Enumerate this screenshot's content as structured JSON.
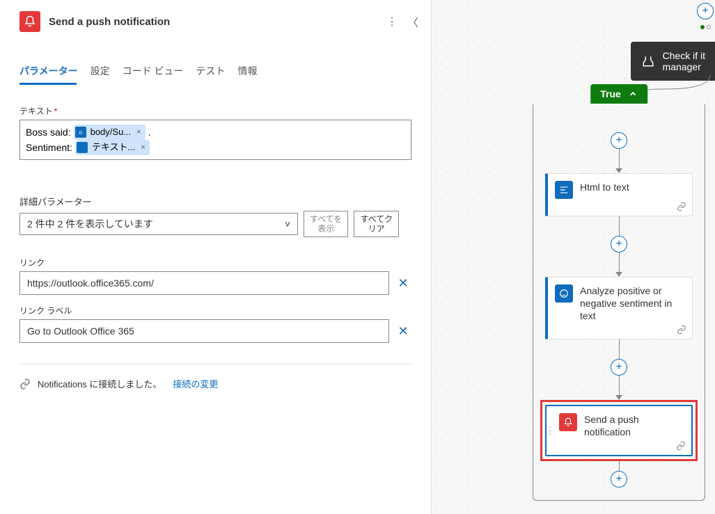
{
  "header": {
    "title": "Send a push notification"
  },
  "tabs": {
    "parameters": "パラメーター",
    "settings": "設定",
    "code_view": "コード ビュー",
    "test": "テスト",
    "info": "情報"
  },
  "text_field": {
    "label": "テキスト",
    "line1_prefix": "Boss said:",
    "token1": "body/Su...",
    "line1_suffix": ".",
    "line2_prefix": "Sentiment:",
    "token2": "テキスト..."
  },
  "adv": {
    "label": "詳細パラメーター",
    "dropdown": "2 件中 2 件を表示しています",
    "show_all": "すべてを\n表示",
    "clear_all": "すべてク\nリア"
  },
  "link": {
    "label": "リンク",
    "value": "https://outlook.office365.com/"
  },
  "link_label": {
    "label": "リンク ラベル",
    "value": "Go to Outlook Office 365"
  },
  "connection": {
    "status": "Notifications に接続しました。",
    "change": "接続の変更"
  },
  "canvas": {
    "condition": "Check if it\nmanager",
    "true_label": "True",
    "card1": "Html to text",
    "card2": "Analyze positive or negative sentiment in text",
    "card3": "Send a push notification"
  }
}
